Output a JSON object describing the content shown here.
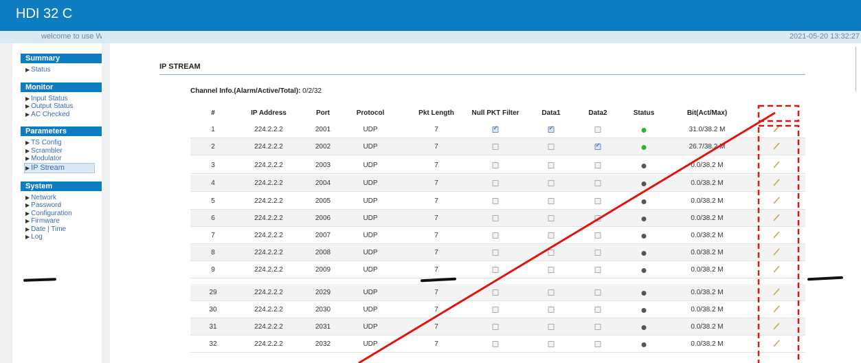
{
  "app": {
    "title": "HDI 32 C"
  },
  "welcome": {
    "text": "welcome to use We",
    "datetime": "2021-05-20 13:32:27"
  },
  "sidebar": {
    "groups": [
      {
        "title": "Summary",
        "items": [
          {
            "label": "Status"
          }
        ]
      },
      {
        "title": "Monitor",
        "items": [
          {
            "label": "Input Status"
          },
          {
            "label": "Output Status"
          },
          {
            "label": "AC Checked"
          }
        ]
      },
      {
        "title": "Parameters",
        "items": [
          {
            "label": "TS Config"
          },
          {
            "label": "Scrambler"
          },
          {
            "label": "Modulator"
          },
          {
            "label": "IP Stream",
            "active": true
          }
        ]
      },
      {
        "title": "System",
        "items": [
          {
            "label": "Network"
          },
          {
            "label": "Password"
          },
          {
            "label": "Configuration"
          },
          {
            "label": "Firmware"
          },
          {
            "label": "Date | Time"
          },
          {
            "label": "Log"
          }
        ]
      }
    ]
  },
  "panel": {
    "title": "IP STREAM",
    "channel_info_label": "Channel Info.(Alarm/Active/Total):",
    "channel_info_value": "0/2/32"
  },
  "table": {
    "headers": [
      "#",
      "IP Address",
      "Port",
      "Protocol",
      "Pkt Length",
      "Null PKT Filter",
      "Data1",
      "Data2",
      "Status",
      "Bit(Act/Max)"
    ],
    "rows": [
      {
        "num": "1",
        "ip": "224.2.2.2",
        "port": "2001",
        "protocol": "UDP",
        "pkt": "7",
        "null_filter": true,
        "data1": true,
        "data2": false,
        "status": "active",
        "bit": "31.0/38.2 M"
      },
      {
        "num": "2",
        "ip": "224.2.2.2",
        "port": "2002",
        "protocol": "UDP",
        "pkt": "7",
        "null_filter": false,
        "data1": false,
        "data2": true,
        "status": "active",
        "bit": "26.7/38.2 M"
      },
      {
        "num": "3",
        "ip": "224.2.2.2",
        "port": "2003",
        "protocol": "UDP",
        "pkt": "7",
        "null_filter": false,
        "data1": false,
        "data2": false,
        "status": "inactive",
        "bit": "0.0/38.2 M"
      },
      {
        "num": "4",
        "ip": "224.2.2.2",
        "port": "2004",
        "protocol": "UDP",
        "pkt": "7",
        "null_filter": false,
        "data1": false,
        "data2": false,
        "status": "inactive",
        "bit": "0.0/38.2 M"
      },
      {
        "num": "5",
        "ip": "224.2.2.2",
        "port": "2005",
        "protocol": "UDP",
        "pkt": "7",
        "null_filter": false,
        "data1": false,
        "data2": false,
        "status": "inactive",
        "bit": "0.0/38.2 M"
      },
      {
        "num": "6",
        "ip": "224.2.2.2",
        "port": "2006",
        "protocol": "UDP",
        "pkt": "7",
        "null_filter": false,
        "data1": false,
        "data2": false,
        "status": "inactive",
        "bit": "0.0/38.2 M"
      },
      {
        "num": "7",
        "ip": "224.2.2.2",
        "port": "2007",
        "protocol": "UDP",
        "pkt": "7",
        "null_filter": false,
        "data1": false,
        "data2": false,
        "status": "inactive",
        "bit": "0.0/38.2 M"
      },
      {
        "num": "8",
        "ip": "224.2.2.2",
        "port": "2008",
        "protocol": "UDP",
        "pkt": "7",
        "null_filter": false,
        "data1": false,
        "data2": false,
        "status": "inactive",
        "bit": "0.0/38.2 M"
      },
      {
        "num": "9",
        "ip": "224.2.2.2",
        "port": "2009",
        "protocol": "UDP",
        "pkt": "7",
        "null_filter": false,
        "data1": false,
        "data2": false,
        "status": "inactive",
        "bit": "0.0/38.2 M"
      },
      {
        "num": "29",
        "ip": "224.2.2.2",
        "port": "2029",
        "protocol": "UDP",
        "pkt": "7",
        "null_filter": false,
        "data1": false,
        "data2": false,
        "status": "inactive",
        "bit": "0.0/38.2 M"
      },
      {
        "num": "30",
        "ip": "224.2.2.2",
        "port": "2030",
        "protocol": "UDP",
        "pkt": "7",
        "null_filter": false,
        "data1": false,
        "data2": false,
        "status": "inactive",
        "bit": "0.0/38.2 M"
      },
      {
        "num": "31",
        "ip": "224.2.2.2",
        "port": "2031",
        "protocol": "UDP",
        "pkt": "7",
        "null_filter": false,
        "data1": false,
        "data2": false,
        "status": "inactive",
        "bit": "0.0/38.2 M"
      },
      {
        "num": "32",
        "ip": "224.2.2.2",
        "port": "2032",
        "protocol": "UDP",
        "pkt": "7",
        "null_filter": false,
        "data1": false,
        "data2": false,
        "status": "inactive",
        "bit": "0.0/38.2 M"
      }
    ]
  },
  "colors": {
    "topbar": "#0d7cc1",
    "sidebar_heading": "#0d7cc1",
    "status_active": "#2bb52b",
    "status_inactive": "#555555",
    "annotation": "#e0140f",
    "edit_icon": "#c9a24a"
  },
  "icons": {
    "edit": "pencil-icon",
    "status": "status-dot-icon",
    "nav_bullet": "triangle-right-icon"
  }
}
